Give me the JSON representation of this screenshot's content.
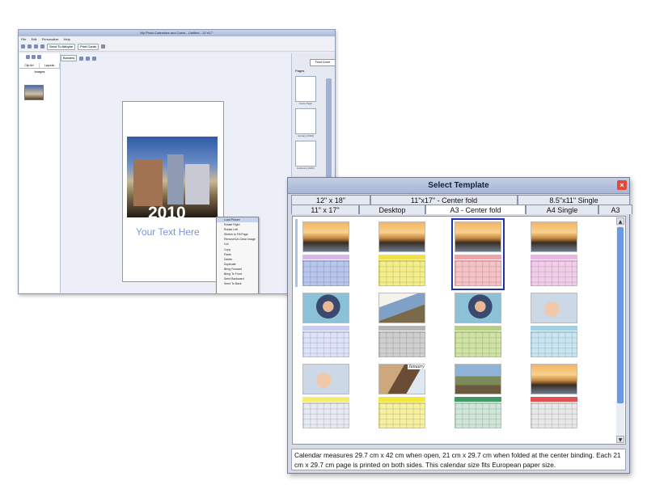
{
  "editor": {
    "title": "My Photo Calendars and Cards - Untitled - 11\"x17\"",
    "menu": [
      "File",
      "Edit",
      "Personalize",
      "Help"
    ],
    "toolbar": {
      "send": "Send To Abbybe",
      "print": "Print Cards"
    },
    "left_tabs": [
      "Clip Art",
      "Layouts"
    ],
    "left_label": "Images",
    "borders_select": "Borders",
    "canvas": {
      "year": "2010",
      "placeholder_text": "Your Text Here"
    },
    "context_menu": [
      "Load Picture",
      "Rotate Right",
      "Rotate Left",
      "Stretch to Fill Page",
      "Remove/Un-Clear Image",
      "Cut",
      "Copy",
      "Paste",
      "Delete",
      "Duplicate",
      "Bring Forward",
      "Bring To Front",
      "Send Backward",
      "Send To Back"
    ],
    "right_panel": {
      "dropdown": "Front Cover",
      "pages_label": "Pages",
      "pages": [
        "Cover Page",
        "January (2010)",
        "February (2010)"
      ]
    }
  },
  "dialog": {
    "title": "Select Template",
    "close": "×",
    "tabs_row1": [
      "12\" x 18\"",
      "11\"x17\" - Center fold",
      "8.5\"x11\" Single"
    ],
    "tabs_row2": [
      "11\" x 17\"",
      "Desktop",
      "A3 - Center fold",
      "A4 Single",
      "A3"
    ],
    "active_tab": "A3 - Center fold",
    "templates": [
      {
        "photo": "sunset",
        "header_color": "#d7b7e8",
        "cell_color": "#b8c6ee"
      },
      {
        "photo": "sunset",
        "header_color": "#f2e24a",
        "cell_color": "#f4ee8a"
      },
      {
        "photo": "sunset",
        "header_color": "#f0a4a8",
        "cell_color": "#f5c2c6",
        "selected": true
      },
      {
        "photo": "sunset",
        "header_color": "#e8b6e0",
        "cell_color": "#f2cde9"
      },
      {
        "photo": "woman",
        "header_color": "#c7cdf2",
        "cell_color": "#dfe3fa"
      },
      {
        "photo": "man",
        "header_color": "#b5b5b5",
        "cell_color": "#cfcfcf"
      },
      {
        "photo": "woman",
        "header_color": "#b6cf82",
        "cell_color": "#cfe3a4"
      },
      {
        "photo": "baby",
        "header_color": "#9fd1e6",
        "cell_color": "#c8e6f2"
      },
      {
        "photo": "baby",
        "header_color": "#f2ee6a",
        "cell_color": "#e8eaf2"
      },
      {
        "photo": "kids",
        "header_color": "#f2e83a",
        "cell_color": "#f6f0a0"
      },
      {
        "photo": "family",
        "header_color": "#3e9b64",
        "cell_color": "#cfe6d8"
      },
      {
        "photo": "sunset",
        "header_color": "#e05050",
        "cell_color": "#e8e8e8"
      }
    ],
    "month_label": "January",
    "description": "Calendar measures 29.7 cm x 42 cm when open, 21 cm x 29.7 cm when folded at the center binding. Each 21 cm x 29.7 cm page is printed on both sides. This calendar size fits European paper size."
  }
}
